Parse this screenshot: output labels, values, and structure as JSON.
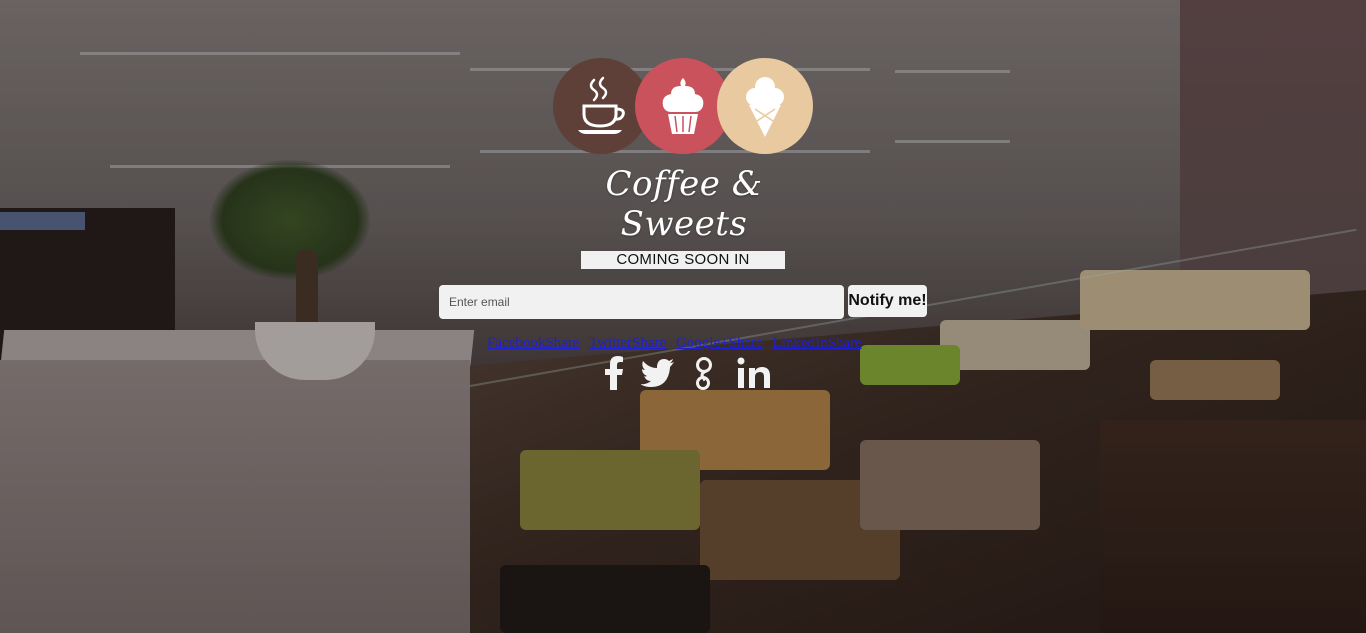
{
  "brand": {
    "name": "Coffee & Sweets",
    "circles": [
      {
        "icon": "coffee-cup-icon",
        "color": "#5e4038"
      },
      {
        "icon": "cupcake-icon",
        "color": "#c9525c"
      },
      {
        "icon": "ice-cream-icon",
        "color": "#e8c9a0"
      }
    ]
  },
  "countdown": {
    "label": "COMING SOON IN"
  },
  "signup": {
    "email_placeholder": "Enter email",
    "email_value": "",
    "button_label": "Notify me!"
  },
  "share": {
    "links": [
      {
        "label": "FacebookShare"
      },
      {
        "label": "TwitterShare"
      },
      {
        "label": "Google+Share"
      },
      {
        "label": "LinkedInShare"
      }
    ]
  },
  "social": {
    "icons": [
      "facebook-icon",
      "twitter-icon",
      "google-plus-icon",
      "linkedin-icon"
    ],
    "icon_color": "#f2f2f2",
    "link_color": "#1f1fd6"
  }
}
